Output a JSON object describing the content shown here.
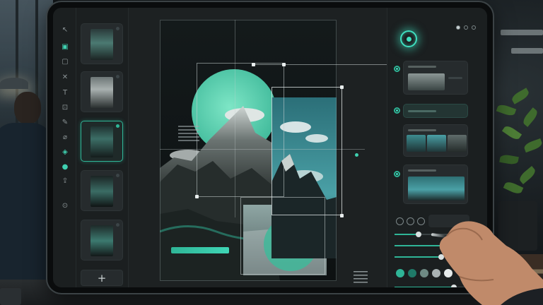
{
  "app": {
    "title": "",
    "accent": "#2fb597",
    "accent_glow": "#3fe0c0",
    "background": "#16191a"
  },
  "toolbar": {
    "tools": [
      {
        "name": "select-icon",
        "glyph": "↖"
      },
      {
        "name": "rectangle-filled-icon",
        "glyph": "▣",
        "active": true
      },
      {
        "name": "rectangle-icon",
        "glyph": "▢"
      },
      {
        "name": "crop-icon",
        "glyph": "✕"
      },
      {
        "name": "text-icon",
        "glyph": "T"
      },
      {
        "name": "image-icon",
        "glyph": "⊡"
      },
      {
        "name": "pen-icon",
        "glyph": "✎"
      },
      {
        "name": "brush-icon",
        "glyph": "⌀"
      },
      {
        "name": "fill-icon",
        "glyph": "◈",
        "active": true
      },
      {
        "name": "color-drop-icon",
        "glyph": "●",
        "active": true
      },
      {
        "name": "export-icon",
        "glyph": "⇪"
      },
      {
        "name": "settings-icon",
        "glyph": "⊙"
      }
    ]
  },
  "layers": {
    "items": [
      {
        "name": "layer-1",
        "selected": false
      },
      {
        "name": "layer-2",
        "selected": false
      },
      {
        "name": "layer-3",
        "selected": true
      },
      {
        "name": "layer-4",
        "selected": false
      },
      {
        "name": "layer-5",
        "selected": false
      }
    ],
    "add_label": "+"
  },
  "canvas": {
    "pager": [
      {
        "color": "#3a4244"
      },
      {
        "color": "#3a4244"
      },
      {
        "color": "#2fb597"
      },
      {
        "color": "#cfd6d6"
      },
      {
        "color": "#9aa4a6"
      }
    ]
  },
  "properties": {
    "swatches": [
      "#2fb597",
      "#1f7a68",
      "#6e8a84",
      "#aab3b4",
      "#e6ebeb"
    ],
    "sliders": [
      {
        "name": "opacity-slider",
        "value": 0.28
      },
      {
        "name": "size-slider",
        "value": 0.62
      },
      {
        "name": "flow-slider",
        "value": 0.55
      },
      {
        "name": "hardness-slider",
        "value": 0.7
      }
    ]
  }
}
